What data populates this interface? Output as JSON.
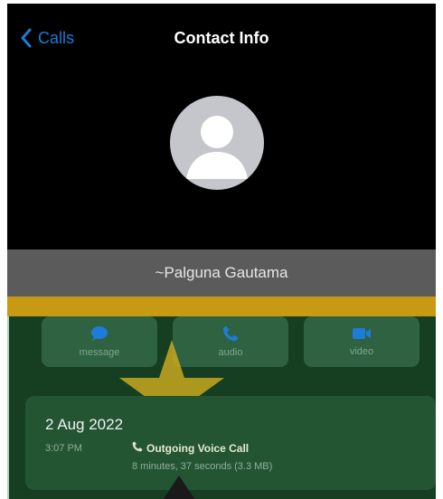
{
  "nav": {
    "back_label": "Calls",
    "title": "Contact Info"
  },
  "contact": {
    "name": "~Palguna Gautama"
  },
  "actions": [
    {
      "label": "message",
      "icon": "chat-bubble-icon"
    },
    {
      "label": "audio",
      "icon": "phone-icon"
    },
    {
      "label": "video",
      "icon": "video-camera-icon"
    }
  ],
  "call_log": {
    "date": "2 Aug 2022",
    "time": "3:07 PM",
    "type": "Outgoing Voice Call",
    "detail": "8 minutes, 37 seconds (3.3 MB)"
  },
  "colors": {
    "accent": "#1e7bd9",
    "flag_yellow": "#c89a14",
    "flag_green": "#163f22"
  }
}
